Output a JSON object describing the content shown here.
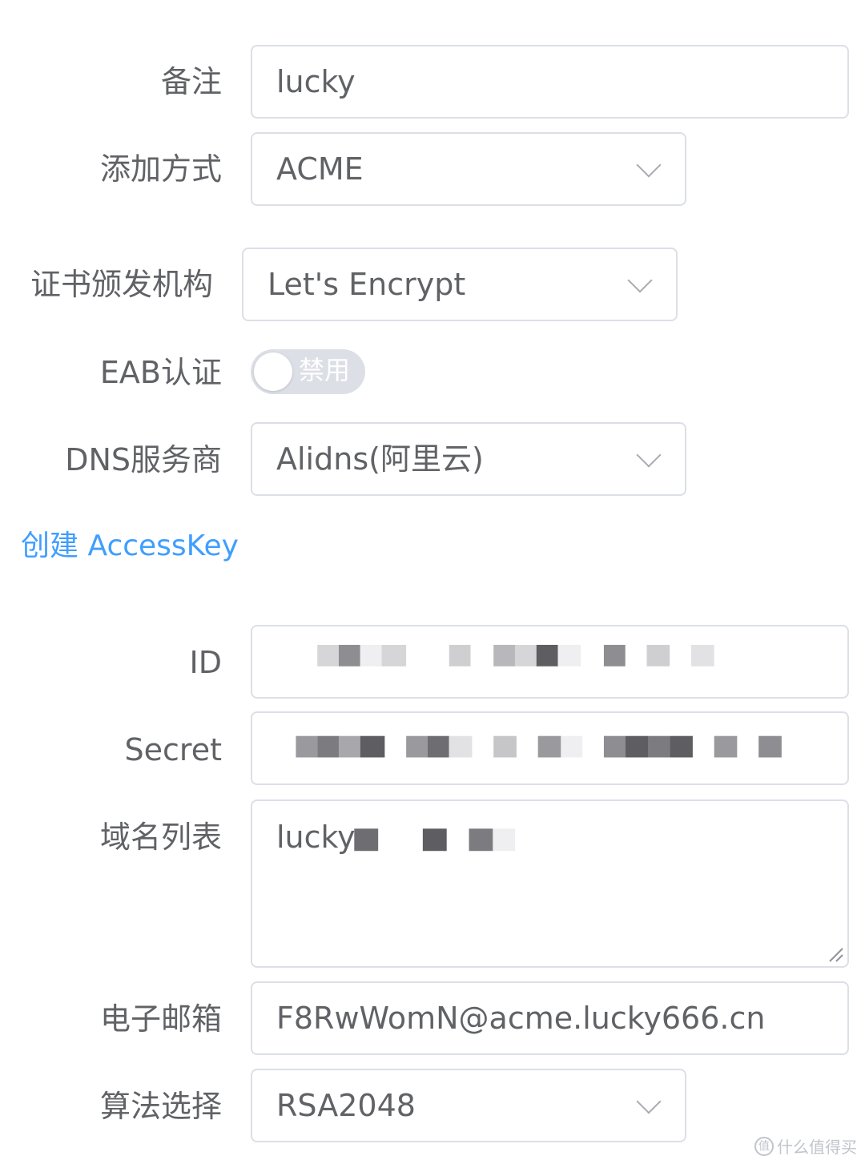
{
  "form": {
    "remark": {
      "label": "备注",
      "value": "lucky"
    },
    "add_method": {
      "label": "添加方式",
      "value": "ACME"
    },
    "ca": {
      "label": "证书颁发机构",
      "value": "Let's Encrypt"
    },
    "eab": {
      "label": "EAB认证",
      "switch_text": "禁用",
      "enabled": false
    },
    "dns": {
      "label": "DNS服务商",
      "value": "Alidns(阿里云)"
    },
    "create_key_link": "创建 AccessKey",
    "id": {
      "label": "ID"
    },
    "secret": {
      "label": "Secret"
    },
    "domains": {
      "label": "域名列表",
      "value": "lucky"
    },
    "email": {
      "label": "电子邮箱",
      "value": "F8RwWomN@acme.lucky666.cn"
    },
    "algorithm": {
      "label": "算法选择",
      "value": "RSA2048"
    }
  },
  "colors": {
    "link": "#409eff",
    "border": "#dcdfe6",
    "text": "#606266"
  },
  "watermark": {
    "text": "什么值得买",
    "icon": "value-logo-icon"
  }
}
